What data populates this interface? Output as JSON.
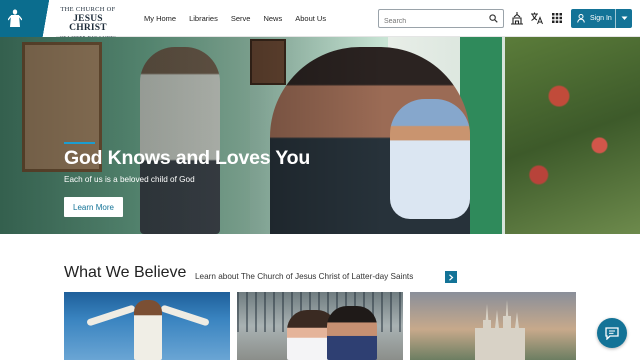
{
  "header": {
    "logo": {
      "line1": "THE CHURCH OF",
      "line2": "JESUS CHRIST",
      "line3": "OF LATTER-DAY SAINTS"
    },
    "nav": [
      "My Home",
      "Libraries",
      "Serve",
      "News",
      "About Us"
    ],
    "search": {
      "placeholder": "Search",
      "value": ""
    },
    "icons": [
      "temple-icon",
      "translate-icon",
      "apps-grid-icon"
    ],
    "signin": {
      "label": "Sign In"
    }
  },
  "hero": {
    "title": "God Knows and Loves You",
    "subtitle": "Each of us is a beloved child of God",
    "button": "Learn More"
  },
  "beliefs": {
    "title": "What We Believe",
    "link": "Learn about The Church of Jesus Christ of Latter-day Saints"
  },
  "colors": {
    "brand": "#137397",
    "logo_block": "#0b6d8e",
    "accent": "#1b9dd0"
  }
}
